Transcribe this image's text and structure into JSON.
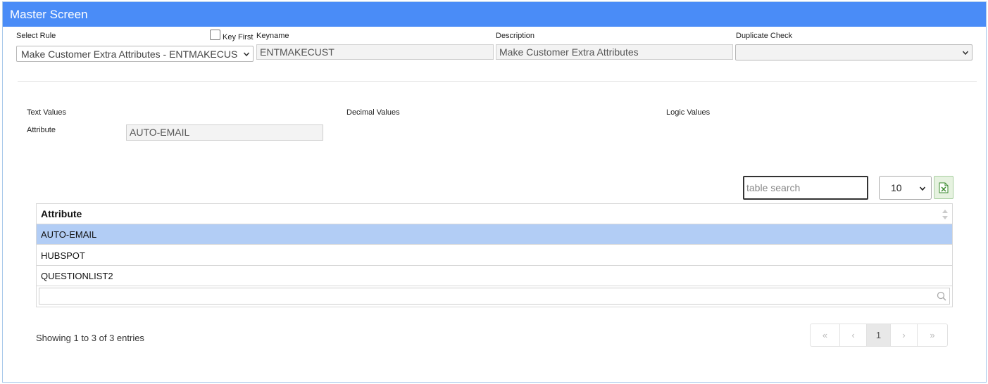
{
  "header": {
    "title": "Master Screen"
  },
  "form": {
    "select_rule_label": "Select Rule",
    "select_rule_value": "Make Customer Extra Attributes - ENTMAKECUS",
    "key_first_label": "Key First",
    "keyname_label": "Keyname",
    "keyname_value": "ENTMAKECUST",
    "description_label": "Description",
    "description_value": "Make Customer Extra Attributes",
    "duplicate_check_label": "Duplicate Check",
    "duplicate_check_value": ""
  },
  "sections": {
    "text_values": "Text Values",
    "decimal_values": "Decimal Values",
    "logic_values": "Logic Values"
  },
  "attribute": {
    "label": "Attribute",
    "value": "AUTO-EMAIL"
  },
  "table_controls": {
    "search_placeholder": "table search",
    "page_size": "10"
  },
  "table": {
    "header": "Attribute",
    "rows": [
      "AUTO-EMAIL",
      "HUBSPOT",
      "QUESTIONLIST2"
    ],
    "selected_row": 0
  },
  "footer": {
    "info": "Showing 1 to 3 of 3 entries",
    "pager": {
      "first": "«",
      "prev": "‹",
      "current": "1",
      "next": "›",
      "last": "»"
    }
  },
  "colors": {
    "header_bg": "#4a8cf7",
    "selected_row": "#b2cdf5"
  },
  "icons": [
    "chevron-down-icon",
    "excel-export-icon",
    "sort-icon",
    "search-icon"
  ]
}
